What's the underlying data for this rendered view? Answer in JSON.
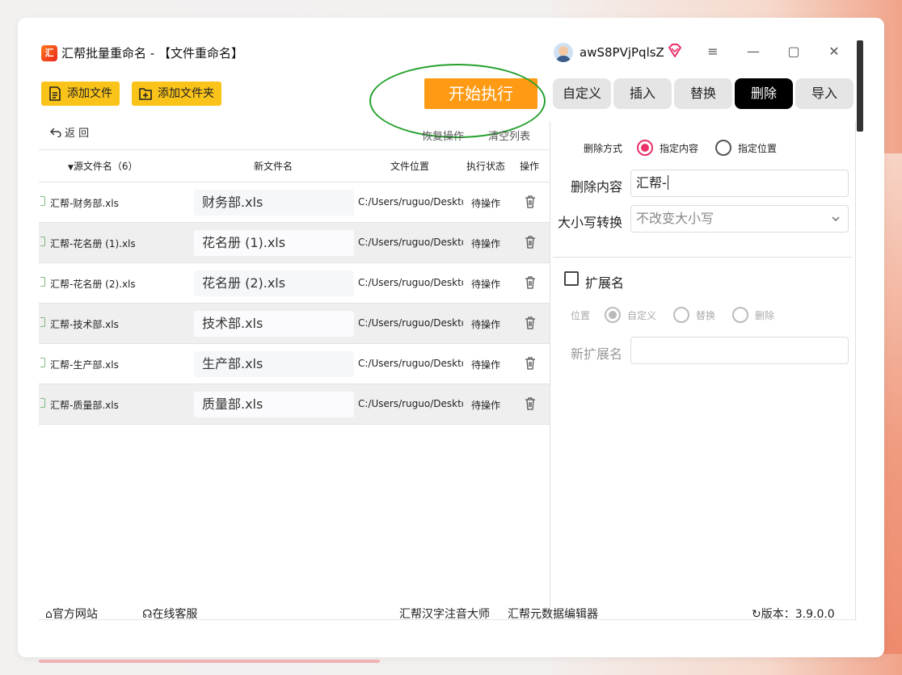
{
  "app": {
    "title": "汇帮批量重命名 - 【文件重命名】",
    "icon_letter": "汇",
    "username": "awS8PVjPqlsZ"
  },
  "window_controls": {
    "menu": "≡",
    "minimize": "—",
    "maximize": "▢",
    "close": "✕"
  },
  "toolbar": {
    "add_file": "添加文件",
    "add_folder": "添加文件夹",
    "start": "开始执行"
  },
  "tabs": [
    {
      "label": "自定义",
      "active": false
    },
    {
      "label": "插入",
      "active": false
    },
    {
      "label": "替换",
      "active": false
    },
    {
      "label": "删除",
      "active": true
    },
    {
      "label": "导入",
      "active": false
    }
  ],
  "list_actions": {
    "back": "返  回",
    "restore": "恢复操作",
    "clear": "清空列表"
  },
  "columns": {
    "source": "源文件名（6）",
    "new_name": "新文件名",
    "location": "文件位置",
    "status": "执行状态",
    "action": "操作"
  },
  "rows": [
    {
      "src": "汇帮-财务部.xls",
      "new": "财务部.xls",
      "path": "C:/Users/ruguo/Desktop",
      "status": "待操作"
    },
    {
      "src": "汇帮-花名册 (1).xls",
      "new": "花名册 (1).xls",
      "path": "C:/Users/ruguo/Desktop",
      "status": "待操作"
    },
    {
      "src": "汇帮-花名册 (2).xls",
      "new": "花名册 (2).xls",
      "path": "C:/Users/ruguo/Desktop",
      "status": "待操作"
    },
    {
      "src": "汇帮-技术部.xls",
      "new": "技术部.xls",
      "path": "C:/Users/ruguo/Desktop",
      "status": "待操作"
    },
    {
      "src": "汇帮-生产部.xls",
      "new": "生产部.xls",
      "path": "C:/Users/ruguo/Desktop",
      "status": "待操作"
    },
    {
      "src": "汇帮-质量部.xls",
      "new": "质量部.xls",
      "path": "C:/Users/ruguo/Desktop",
      "status": "待操作"
    }
  ],
  "panel": {
    "delete_mode_label": "删除方式",
    "mode_content": "指定内容",
    "mode_position": "指定位置",
    "delete_content_label": "删除内容",
    "delete_content_value": "汇帮-",
    "case_label": "大小写转换",
    "case_value": "不改变大小写",
    "ext_label": "扩展名",
    "position_label": "位置",
    "ext_custom": "自定义",
    "ext_replace": "替换",
    "ext_delete": "删除",
    "new_ext_label": "新扩展名",
    "new_ext_value": ""
  },
  "footer": {
    "website": "官方网站",
    "support": "在线客服",
    "product1": "汇帮汉字注音大师",
    "product2": "汇帮元数据编辑器",
    "version": "版本：3.9.0.0"
  },
  "colors": {
    "accent_yellow": "#f9c31a",
    "start_orange": "#ff9a14",
    "radio_pink": "#e8336a",
    "ellipse_green": "#25a02d"
  }
}
